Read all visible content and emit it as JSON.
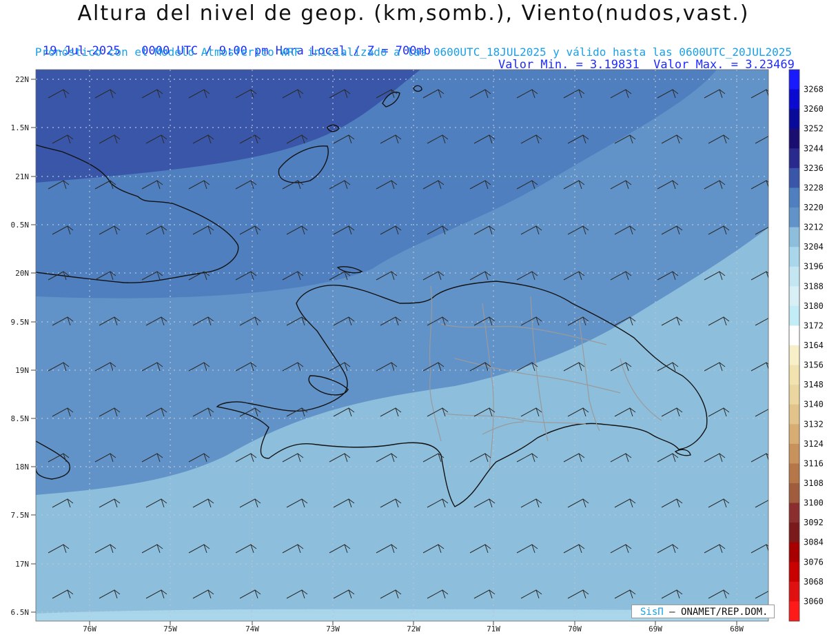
{
  "header": {
    "title": "Altura del nivel de geop. (km,somb.), Viento(nudos,vast.)",
    "subtitle_left": "19-Jul-2025   0000 UTC / 9:00 pm Hora Local / Z = 700mb",
    "subtitle_right": "Valor Min. = 3.19831  Valor Max. = 3.23469",
    "subtitle2": "Pronóstico con el Modelo Atmosferico WRF inicializado a las 0600UTC_18JUL2025 y válido hasta las  0600UTC_20JUL2025"
  },
  "map": {
    "lat_labels": [
      "22N",
      "1.5N",
      "21N",
      "0.5N",
      "20N",
      "9.5N",
      "19N",
      "8.5N",
      "18N",
      "7.5N",
      "17N",
      "6.5N"
    ],
    "lon_labels": [
      "76W",
      "75W",
      "74W",
      "73W",
      "72W",
      "71W",
      "70W",
      "69W",
      "68W"
    ],
    "field_colors": {
      "dark": "#3a56a8",
      "mid": "#4f7fbe",
      "mid2": "#6293c8",
      "light": "#8dbfdd",
      "lighter": "#a9d6ea"
    }
  },
  "colorbar": {
    "labels": [
      "3268",
      "3260",
      "3252",
      "3244",
      "3236",
      "3228",
      "3220",
      "3212",
      "3204",
      "3196",
      "3188",
      "3180",
      "3172",
      "3164",
      "3156",
      "3148",
      "3140",
      "3132",
      "3124",
      "3116",
      "3108",
      "3100",
      "3092",
      "3084",
      "3076",
      "3068",
      "3060"
    ],
    "colors": [
      "#1a1aff",
      "#0a0ad0",
      "#0a0a9a",
      "#1a0e70",
      "#2a2a8e",
      "#3a56a8",
      "#4f7fbe",
      "#6293c8",
      "#8dbfdd",
      "#a9d6ea",
      "#c4e6f2",
      "#d8eff6",
      "#c2ecf6",
      "#ffffff",
      "#f7efc8",
      "#f2e2b0",
      "#ecd6a0",
      "#e2c48a",
      "#d8ad74",
      "#c8925c",
      "#b57748",
      "#a05c3c",
      "#8a2e2e",
      "#7a1a1a",
      "#a80000",
      "#c80000",
      "#e01010",
      "#ff1a1a"
    ]
  },
  "watermark": {
    "brand": "SisΠ",
    "text": "– ONAMET/REP.DOM."
  }
}
